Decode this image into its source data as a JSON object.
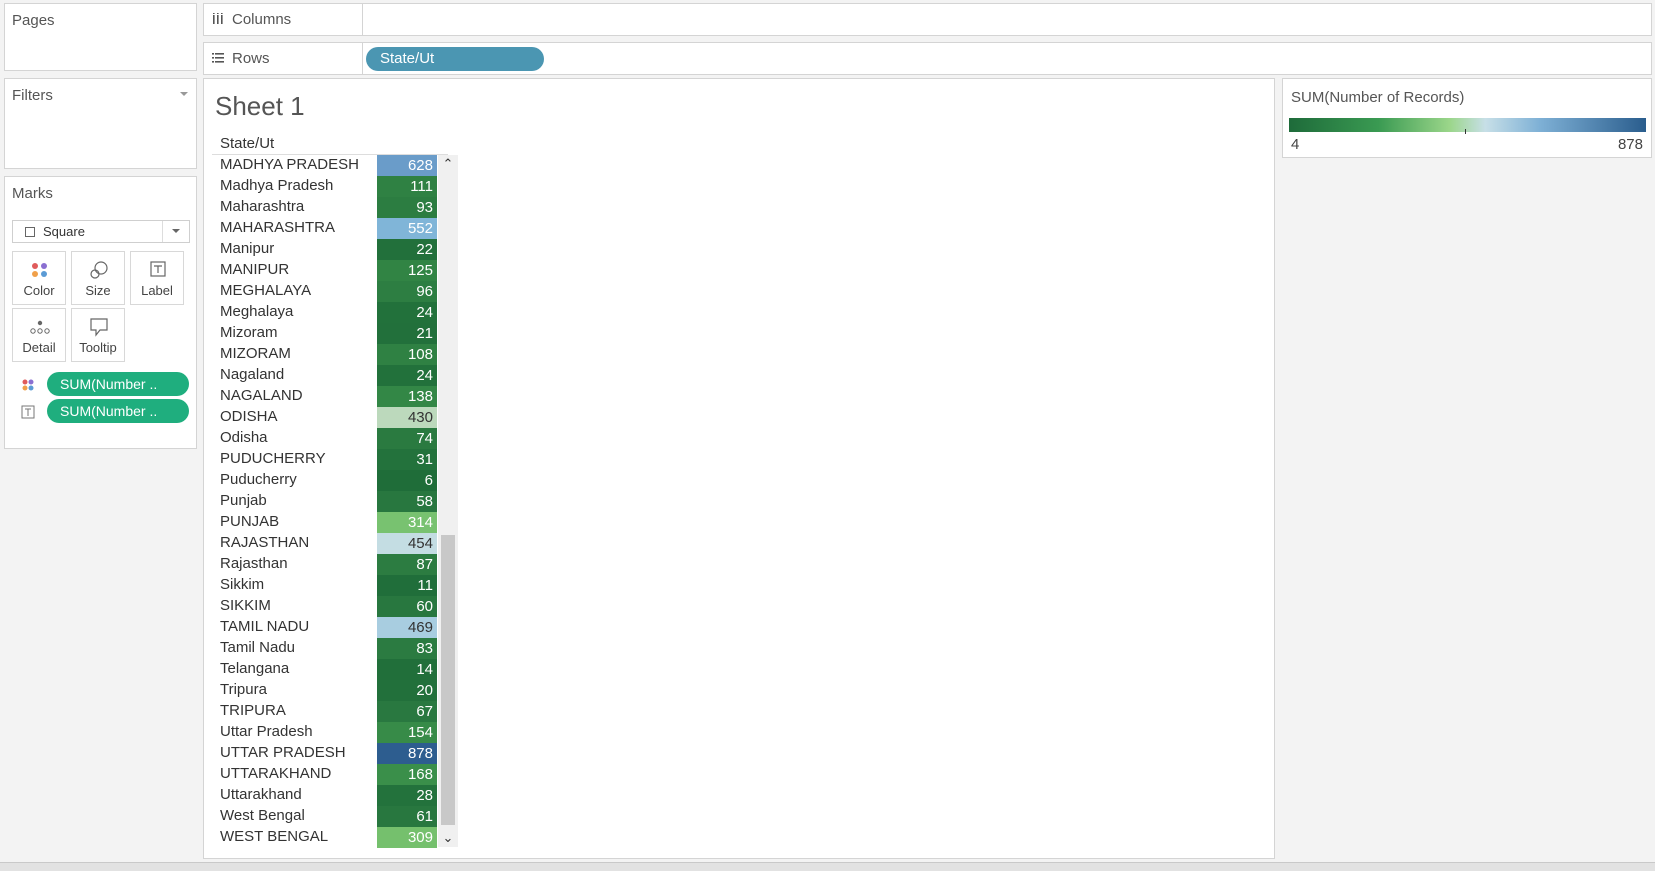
{
  "pages": {
    "title": "Pages"
  },
  "filters": {
    "title": "Filters"
  },
  "marks": {
    "title": "Marks",
    "mark_type": "Square",
    "buttons": {
      "color": "Color",
      "size": "Size",
      "label": "Label",
      "detail": "Detail",
      "tooltip": "Tooltip"
    },
    "pills": [
      "SUM(Number ..",
      "SUM(Number .."
    ]
  },
  "shelves": {
    "columns": {
      "label": "Columns"
    },
    "rows": {
      "label": "Rows",
      "pill": "State/Ut"
    }
  },
  "sheet": {
    "title": "Sheet 1",
    "column_header": "State/Ut"
  },
  "legend": {
    "title": "SUM(Number of Records)",
    "min": "4",
    "max": "878"
  },
  "table": [
    {
      "state": "MADHYA PRADESH",
      "value": "628",
      "color": "#6a9cc9"
    },
    {
      "state": "Madhya Pradesh",
      "value": "111",
      "color": "#2f8143"
    },
    {
      "state": "Maharashtra",
      "value": "93",
      "color": "#2c7d41"
    },
    {
      "state": "MAHARASHTRA",
      "value": "552",
      "color": "#80b5d8"
    },
    {
      "state": "Manipur",
      "value": "22",
      "color": "#22703b"
    },
    {
      "state": "MANIPUR",
      "value": "125",
      "color": "#318444"
    },
    {
      "state": "MEGHALAYA",
      "value": "96",
      "color": "#2d7e42"
    },
    {
      "state": "Meghalaya",
      "value": "24",
      "color": "#22713b"
    },
    {
      "state": "Mizoram",
      "value": "21",
      "color": "#22703b"
    },
    {
      "state": "MIZORAM",
      "value": "108",
      "color": "#2f8143"
    },
    {
      "state": "Nagaland",
      "value": "24",
      "color": "#22713b"
    },
    {
      "state": "NAGALAND",
      "value": "138",
      "color": "#338746"
    },
    {
      "state": "ODISHA",
      "value": "430",
      "color": "#bcd9bc"
    },
    {
      "state": "Odisha",
      "value": "74",
      "color": "#2a7a40"
    },
    {
      "state": "PUDUCHERRY",
      "value": "31",
      "color": "#23723c"
    },
    {
      "state": "Puducherry",
      "value": "6",
      "color": "#1f6d39"
    },
    {
      "state": "Punjab",
      "value": "58",
      "color": "#28773f"
    },
    {
      "state": "PUNJAB",
      "value": "314",
      "color": "#78c270"
    },
    {
      "state": "RAJASTHAN",
      "value": "454",
      "color": "#c4dde3"
    },
    {
      "state": "Rajasthan",
      "value": "87",
      "color": "#2c7c41"
    },
    {
      "state": "Sikkim",
      "value": "11",
      "color": "#206e3a"
    },
    {
      "state": "SIKKIM",
      "value": "60",
      "color": "#28773f"
    },
    {
      "state": "TAMIL NADU",
      "value": "469",
      "color": "#a8cde0"
    },
    {
      "state": "Tamil Nadu",
      "value": "83",
      "color": "#2b7b41"
    },
    {
      "state": "Telangana",
      "value": "14",
      "color": "#216f3a"
    },
    {
      "state": "Tripura",
      "value": "20",
      "color": "#22703b"
    },
    {
      "state": "TRIPURA",
      "value": "67",
      "color": "#297840"
    },
    {
      "state": "Uttar Pradesh",
      "value": "154",
      "color": "#378b48"
    },
    {
      "state": "UTTAR PRADESH",
      "value": "878",
      "color": "#2d5d8f"
    },
    {
      "state": "UTTARAKHAND",
      "value": "168",
      "color": "#3a8f4a"
    },
    {
      "state": "Uttarakhand",
      "value": "28",
      "color": "#23723c"
    },
    {
      "state": "West Bengal",
      "value": "61",
      "color": "#28773f"
    },
    {
      "state": "WEST BENGAL",
      "value": "309",
      "color": "#75c06d"
    }
  ]
}
